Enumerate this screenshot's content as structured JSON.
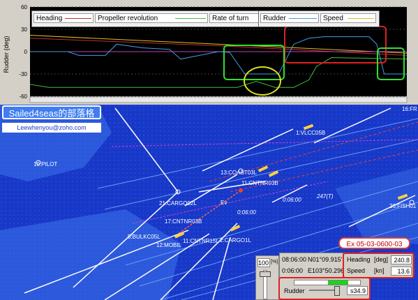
{
  "chart": {
    "legend": [
      {
        "label": "Heading",
        "color": "#c03030"
      },
      {
        "label": "Propeller revolution",
        "color": "#40c040"
      },
      {
        "label": "Rate of turn",
        "color": "#c040c0"
      },
      {
        "label": "Rudder",
        "color": "#40a0e0"
      },
      {
        "label": "Speed",
        "color": "#e0c020"
      }
    ],
    "ylabel": "Rudder (deg)",
    "yticks": [
      "60",
      "30",
      "0",
      "-30",
      "-60"
    ]
  },
  "map": {
    "vessels": [
      "16:FR",
      "1:VLCC05B",
      "10:PILOT",
      "13:COAST03L",
      "11:CNTNR03B",
      "21:CARGO02L",
      "17:CNTNR03B",
      "5:BULKC05L",
      "12:MOBIL",
      "11:CNTNR15L",
      "2:CARGO1L",
      "26:FISH01",
      "Ev"
    ],
    "bearing": "247(T)",
    "time": "0:06:00",
    "time2": "0:06:00"
  },
  "blog": {
    "title": "Sailed4seas的部落格",
    "email": "Leewhenyou@zoho.com"
  },
  "exercise_label": "Ex 05-03-0600-03",
  "instruments": {
    "throttle_value": "100",
    "throttle_unit": "[%]",
    "clock_time": "08:06:00",
    "elapsed_time": "0:06:00",
    "latitude": "N01°09.915'",
    "longitude": "E103°50.296'",
    "heading_label": "Heading",
    "heading_unit": "[deg]",
    "heading_value": "240.8",
    "speed_label": "Speed",
    "speed_unit": "[kn]",
    "speed_value": "13.6",
    "rudder_label": "Rudder",
    "rudder_value": "s34.9",
    "rudder_fill": 0.8
  }
}
